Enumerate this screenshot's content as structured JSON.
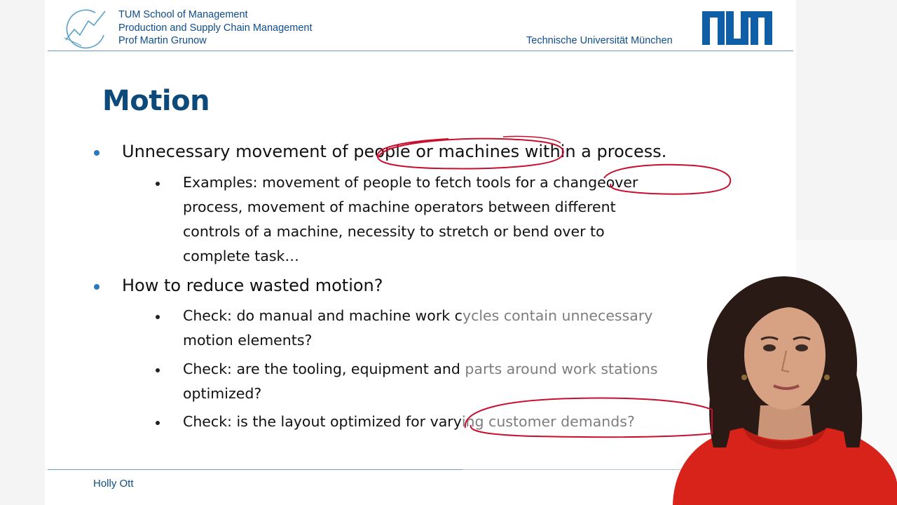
{
  "header": {
    "school": "TUM School of Management",
    "chair": "Production and Supply Chain Management",
    "professor": "Prof Martin Grunow",
    "university": "Technische Universität München"
  },
  "slide": {
    "title": "Motion",
    "bullets": [
      {
        "text": "Unnecessary movement of people or machines within a process.",
        "sub": [
          {
            "lines": [
              "Examples: movement of people to fetch tools for a changeover",
              "process, movement of machine operators between different",
              "controls of a machine, necessity to stretch or bend over to",
              "complete task…"
            ]
          }
        ]
      },
      {
        "text": "How to reduce wasted motion?",
        "sub": [
          {
            "lines": [
              "Check: do manual and machine work cycles contain unnecessary",
              "motion elements?"
            ]
          },
          {
            "lines": [
              "Check: are the tooling, equipment and parts around work stations",
              "optimized?"
            ]
          },
          {
            "lines": [
              "Check: is the layout optimized for varying customer demands?"
            ]
          }
        ]
      }
    ]
  },
  "footer": {
    "presenter": "Holly Ott"
  },
  "colors": {
    "tum_blue": "#0f4d8a",
    "title_blue": "#0b4a7a",
    "bullet_blue": "#2d78b8",
    "annotation_red": "#c8102e"
  },
  "icons": [
    "institution-logo-icon",
    "tum-logo-icon",
    "presenter-video"
  ]
}
